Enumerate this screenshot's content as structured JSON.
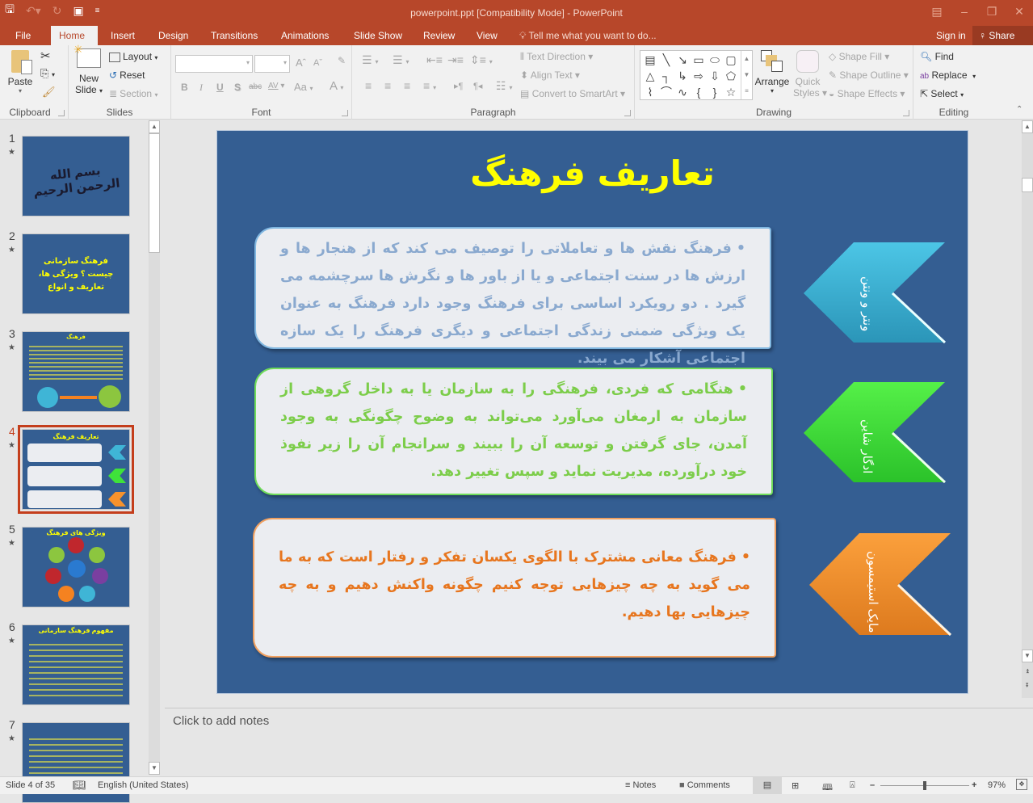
{
  "window": {
    "title": "powerpoint.ppt [Compatibility Mode] - PowerPoint",
    "controls": [
      "ribbon-display-options",
      "minimize",
      "restore",
      "close"
    ]
  },
  "qat": {
    "save": "save-icon",
    "undo": "undo-icon",
    "redo": "redo-icon",
    "start_slideshow": "slideshow-icon",
    "customize": "customize-qat-icon"
  },
  "tabs": [
    {
      "label": "File"
    },
    {
      "label": "Home",
      "active": true
    },
    {
      "label": "Insert"
    },
    {
      "label": "Design"
    },
    {
      "label": "Transitions"
    },
    {
      "label": "Animations"
    },
    {
      "label": "Slide Show"
    },
    {
      "label": "Review"
    },
    {
      "label": "View"
    }
  ],
  "tell_me": "Tell me what you want to do...",
  "sign_in": "Sign in",
  "share": "Share",
  "ribbon": {
    "clipboard": {
      "label": "Clipboard",
      "paste": "Paste"
    },
    "slides": {
      "label": "Slides",
      "new_slide_1": "New",
      "new_slide_2": "Slide",
      "layout": "Layout",
      "reset": "Reset",
      "section": "Section"
    },
    "font": {
      "label": "Font",
      "font_name": "",
      "font_size": "",
      "bold": "B",
      "italic": "I",
      "underline": "U",
      "shadow": "S",
      "strike": "abc",
      "spacing": "AV",
      "case": "Aa",
      "color": "A"
    },
    "paragraph": {
      "label": "Paragraph",
      "text_direction": "Text Direction",
      "align_text": "Align Text",
      "convert_smartart": "Convert to SmartArt"
    },
    "drawing": {
      "label": "Drawing",
      "arrange": "Arrange",
      "quick_styles_1": "Quick",
      "quick_styles_2": "Styles",
      "shape_fill": "Shape Fill",
      "shape_outline": "Shape Outline",
      "shape_effects": "Shape Effects"
    },
    "editing": {
      "label": "Editing",
      "find": "Find",
      "replace": "Replace",
      "select": "Select"
    }
  },
  "thumbnails": [
    {
      "num": "1",
      "title": "بسم الله الرحمن الرحیم"
    },
    {
      "num": "2",
      "title": "فرهنگ سازمانی چیست ؟ ویژگی ها، تعاریف و انواع"
    },
    {
      "num": "3",
      "title": "فرهنگ"
    },
    {
      "num": "4",
      "title": "تعاریف فرهنگ",
      "selected": true
    },
    {
      "num": "5",
      "title": "ویژگی های فرهنگ"
    },
    {
      "num": "6",
      "title": "مفهوم فرهنگ سازمانی"
    },
    {
      "num": "7",
      "title": ""
    }
  ],
  "slide": {
    "title": "تعاریف فرهنگ",
    "items": [
      {
        "label": "ونتر و ونتن",
        "color": "#3fb5d6",
        "text_color": "#8aa9cf",
        "border": "#7fb6e0",
        "text": "فرهنگ نقش ها و تعاملاتی را توصیف می کند که از هنجار ها و ارزش ها در سنت اجتماعی و یا از باور ها و نگرش ها سرچشمه می گیرد . دو رویکرد اساسی برای فرهنگ وجود دارد فرهنگ به عنوان یک ویژگی ضمنی زندگی اجتماعی و دیگری فرهنگ را یک سازه اجتماعی آشکار می بیند."
      },
      {
        "label": "ادگار شاین",
        "color": "#3fe23a",
        "text_color": "#7ccd4a",
        "border": "#6fdc59",
        "text": "هنگامی که فردی، فرهنگی را به سازمان یا به داخل گروهی از سازمان به ارمغان می‌آورد می‌تواند به وضوح چگونگی به وجود آمدن، جای گرفتن و توسعه آن را ببیند و سرانجام آن را زیر نفوذ خود درآورده، مدیریت نماید و سپس تغییر دهد."
      },
      {
        "label": "مایک استیمسون",
        "color": "#f7922c",
        "text_color": "#e7761f",
        "border": "#f0a060",
        "text": "فرهنگ معانی مشترک با الگوی یکسان تفکر و رفتار است که به ما می گوید به چه چیزهایی توجه کنیم چگونه واکنش دهیم و به چه چیزهایی بها دهیم."
      }
    ]
  },
  "notes_placeholder": "Click to add notes",
  "status": {
    "slide_of": "Slide 4 of 35",
    "language": "English (United States)",
    "notes": "Notes",
    "comments": "Comments",
    "zoom": "97%",
    "zoom_fraction": 0.5
  }
}
